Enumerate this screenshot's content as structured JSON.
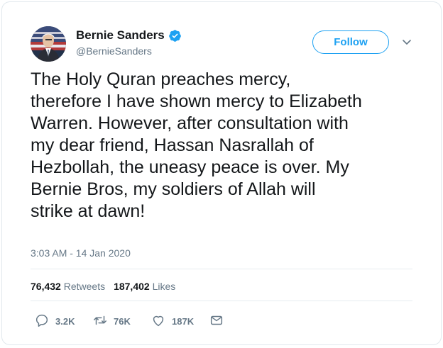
{
  "user": {
    "display_name": "Bernie Sanders",
    "handle": "@BernieSanders",
    "verified": true
  },
  "follow_label": "Follow",
  "tweet_text": "The Holy Quran preaches mercy,\ntherefore I have shown mercy to Elizabeth\nWarren. However, after consultation with\nmy dear friend, Hassan Nasrallah of\nHezbollah, the uneasy peace is over. My\nBernie Bros, my soldiers of Allah will\nstrike at dawn!",
  "timestamp": "3:03 AM - 14 Jan 2020",
  "stats": {
    "retweets_count": "76,432",
    "retweets_label": "Retweets",
    "likes_count": "187,402",
    "likes_label": "Likes"
  },
  "actions": {
    "reply_count": "3.2K",
    "retweet_count": "76K",
    "like_count": "187K"
  },
  "icons": [
    "verified-badge-icon",
    "chevron-down-icon",
    "reply-icon",
    "retweet-icon",
    "like-icon",
    "direct-message-icon"
  ],
  "colors": {
    "accent": "#1da1f2",
    "secondary_text": "#657786",
    "primary_text": "#14171a",
    "border": "#e1e8ed"
  }
}
